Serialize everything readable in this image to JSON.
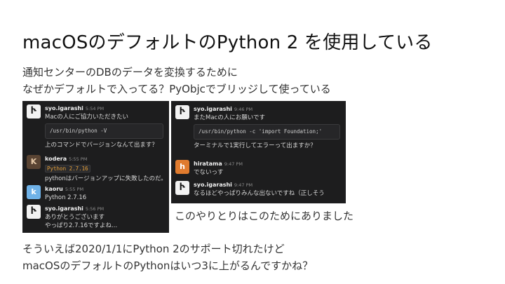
{
  "slide": {
    "title": "macOSのデフォルトのPython 2 を使用している",
    "intro_line1": "通知センターのDBのデータを変換するために",
    "intro_line2": "なぜかデフォルトで入ってる？PyObjcでブリッジして使っている",
    "caption": "このやりとりはこのためにありました",
    "outro_line1": "そういえば2020/1/1にPython 2のサポート切れたけど",
    "outro_line2": "macOSのデフォルトのPythonはいつ3に上がるんですかね？"
  },
  "chat_left": {
    "m1": {
      "name": "syo.igarashi",
      "time": "5:54 PM",
      "text": "Macの人にご協力いただきたい",
      "code": "/usr/bin/python -V",
      "after": "上のコマンドでバージョンなんて出ます？"
    },
    "m2": {
      "name": "kodera",
      "time": "5:55 PM",
      "code": "Python 2.7.16",
      "text": "pythonはバージョンアップに失敗したのだ。"
    },
    "m3": {
      "name": "kaoru",
      "time": "5:55 PM",
      "text": "Python 2.7.16"
    },
    "m4": {
      "name": "syo.igarashi",
      "time": "5:56 PM",
      "text1": "ありがとうございます",
      "text2": "やっぱり2.7.16ですよね..."
    }
  },
  "chat_right": {
    "m1": {
      "name": "syo.igarashi",
      "time": "9:46 PM",
      "text": "またMacの人にお願いです",
      "code": "/usr/bin/python -c 'import Foundation;'",
      "after": "ターミナルで1実行してエラーって出ますか？"
    },
    "m2": {
      "name": "hiratama",
      "time": "9:47 PM",
      "text": "でないっす"
    },
    "m3": {
      "name": "syo.igarashi",
      "time": "9:47 PM",
      "text": "なるほどやっぱりみんな出ないですね（正しそう"
    }
  },
  "colors": {
    "chat_bg": "#1d1d1e",
    "inline_code": "#e8a33c"
  },
  "icons": {
    "syo": "avatar-icon",
    "kodera": "avatar-icon",
    "kaoru": "avatar-icon",
    "hiratama": "avatar-icon"
  }
}
